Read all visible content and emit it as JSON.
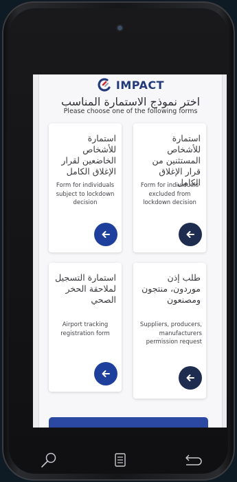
{
  "header": {
    "logo_text": "IMPACT",
    "title_ar": "اختر نموذج الاستمارة المناسب",
    "title_en": "Please choose one of the following forms"
  },
  "cards": [
    {
      "ar": "استمارة للأشخاص المستثنين من قرار الإغلاق الكامل",
      "en": "Form for individuals excluded from lockdown decision",
      "button": "arrow-left-icon"
    },
    {
      "ar": "استمارة للأشخاص الخاضعين لقرار الإغلاق الكامل",
      "en": "Form for individuals subject to lockdown decision",
      "button": "arrow-left-icon"
    },
    {
      "ar": "طلب إذن موردون، منتجون ومصنعون",
      "en": "Suppliers, producers, manufacturers permission request",
      "button": "arrow-left-icon"
    },
    {
      "ar": "استمارة التسجيل لملاحقة الحخر الصحي",
      "en": "Airport tracking registration form",
      "button": "arrow-left-icon"
    }
  ],
  "softkeys": [
    "search-icon",
    "menu-icon",
    "back-icon"
  ],
  "colors": {
    "brand_dark": "#233a7a",
    "button_dark": "#1e2d4f",
    "button_blue": "#1f3f9c",
    "bar_blue": "#2b49a3"
  }
}
